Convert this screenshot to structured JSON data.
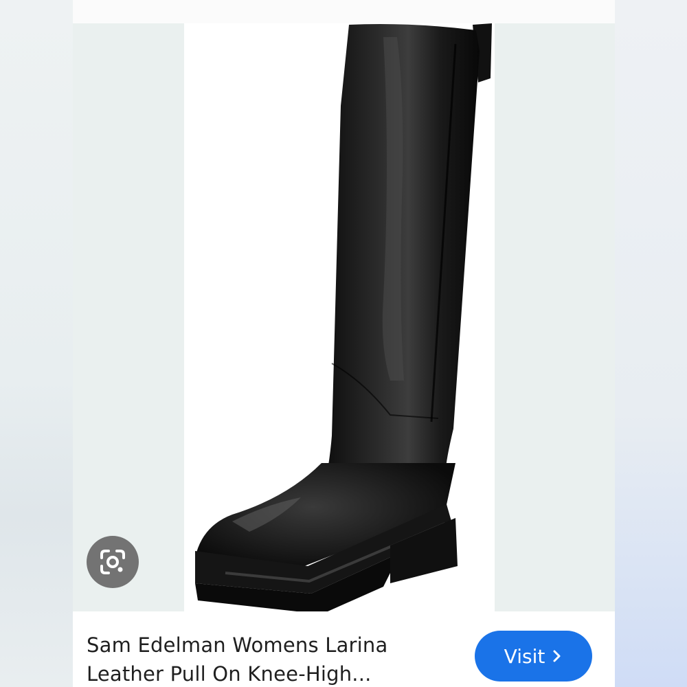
{
  "result": {
    "title_line1": "Sam Edelman Womens Larina",
    "title_line2": "Leather Pull On Knee-High...",
    "visit_label": "Visit",
    "image_alt": "Black leather knee-high pull-on boot"
  },
  "icons": {
    "lens": "google-lens-icon",
    "visit_chevron": "chevron-right-icon"
  },
  "colors": {
    "visit_button": "#1a73e8",
    "lens_button": "#737373",
    "text": "#1f1f1f"
  }
}
